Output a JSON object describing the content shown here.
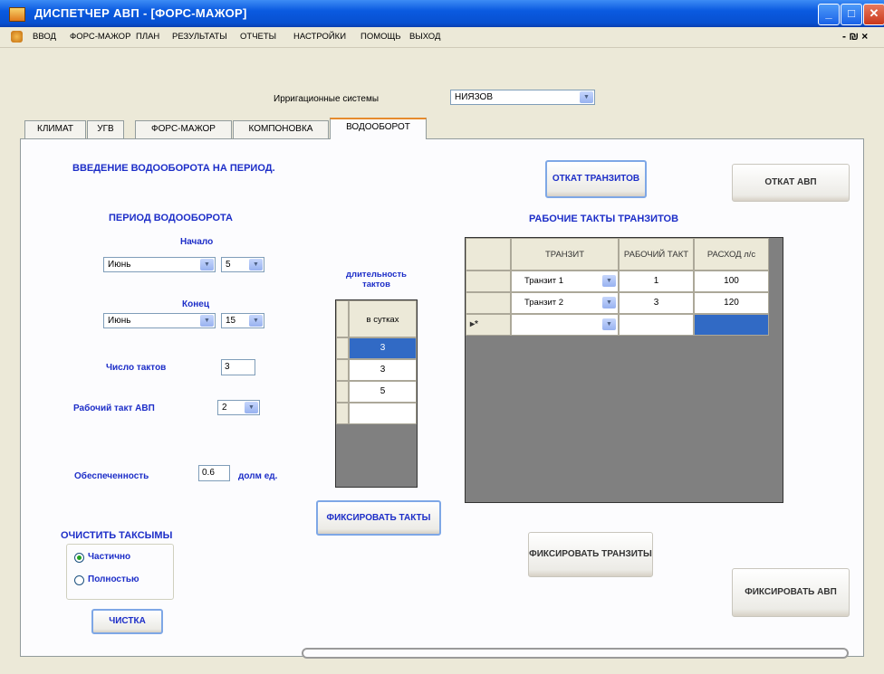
{
  "window": {
    "title": "ДИСПЕТЧЕР АВП - [ФОРС-МАЖОР]"
  },
  "menu": {
    "items": [
      "ВВОД",
      "ФОРС-МАЖОР",
      "ПЛАН",
      "РЕЗУЛЬТАТЫ",
      "ОТЧЕТЫ",
      "НАСТРОЙКИ",
      "ПОМОЩЬ",
      "ВЫХОД"
    ],
    "right_controls": "- ₪ ×"
  },
  "irrigation": {
    "label": "Ирригационные системы",
    "value": "НИЯЗОВ"
  },
  "tabs": [
    "КЛИМАТ",
    "УГВ",
    "ФОРС-МАЖОР",
    "КОМПОНОВКА",
    "ВОДООБОРОТ"
  ],
  "active_tab": "ВОДООБОРОТ",
  "main": {
    "heading": "ВВЕДЕНИЕ ВОДООБОРОТА НА ПЕРИОД.",
    "btn_rollback_transits": "ОТКАТ ТРАНЗИТОВ",
    "btn_rollback_avp": "ОТКАТ АВП",
    "period_title": "ПЕРИОД ВОДООБОРОТА",
    "start_label": "Начало",
    "start_month": "Июнь",
    "start_day": "5",
    "end_label": "Конец",
    "end_month": "Июнь",
    "end_day": "15",
    "tacts_count_label": "Число тактов",
    "tacts_count": "3",
    "work_tact_label": "Рабочий такт АВП",
    "work_tact": "2",
    "security_label": "Обеспеченность",
    "security_value": "0.6",
    "security_unit": "долм ед.",
    "clear_title": "ОЧИСТИТЬ ТАКСЫМЫ",
    "radio_partial": "Частично",
    "radio_full": "Полностью",
    "btn_clear": "ЧИСТКА",
    "duration_label": "длительность тактов",
    "duration_col": "в сутках",
    "durations": [
      "3",
      "3",
      "5",
      ""
    ],
    "btn_fix_tacts": "ФИКСИРОВАТЬ ТАКТЫ",
    "transits_title": "РАБОЧИЕ ТАКТЫ ТРАНЗИТОВ",
    "transits_headers": [
      "ТРАНЗИТ",
      "РАБОЧИЙ ТАКТ",
      "РАСХОД л/с"
    ],
    "transits_rows": [
      {
        "name": "Транзит 1",
        "tact": "1",
        "flow": "100"
      },
      {
        "name": "Транзит 2",
        "tact": "3",
        "flow": "120"
      }
    ],
    "new_row_marker": "▸*",
    "btn_fix_transits": "ФИКСИРОВАТЬ ТРАНЗИТЫ",
    "btn_fix_avp": "ФИКСИРОВАТЬ АВП"
  }
}
